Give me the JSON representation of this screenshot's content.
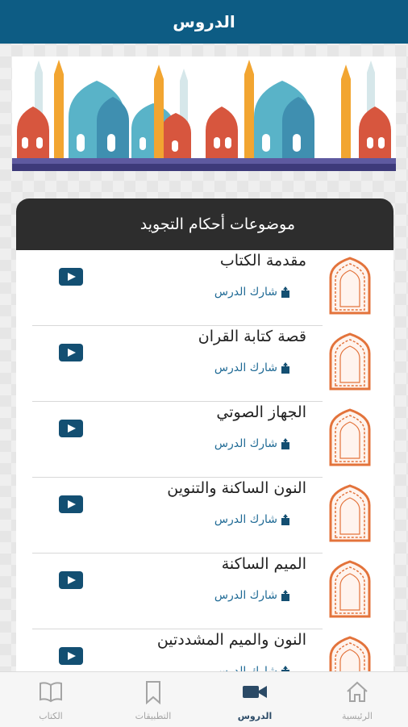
{
  "header": {
    "title": "الدروس"
  },
  "section": {
    "title": "موضوعات أحكام التجويد"
  },
  "lessons": [
    {
      "title": "مقدمة الكتاب",
      "share_label": "شارك الدرس"
    },
    {
      "title": "قصة كتابة القران",
      "share_label": "شارك الدرس"
    },
    {
      "title": "الجهاز الصوتي",
      "share_label": "شارك الدرس"
    },
    {
      "title": "النون الساكنة والتنوين",
      "share_label": "شارك الدرس"
    },
    {
      "title": "الميم الساكنة",
      "share_label": "شارك الدرس"
    },
    {
      "title": "النون والميم المشددتين",
      "share_label": "شارك الدرس"
    }
  ],
  "tabs": [
    {
      "label": "الرئيسية",
      "icon": "home-icon"
    },
    {
      "label": "الدروس",
      "icon": "video-icon",
      "active": true
    },
    {
      "label": "التطبيقات",
      "icon": "bookmark-icon"
    },
    {
      "label": "الكتاب",
      "icon": "book-icon"
    }
  ],
  "colors": {
    "primary": "#0d5c84",
    "header_dark": "#2d2d2d",
    "thumb_orange": "#e3733b",
    "active_tab": "#2b4a66",
    "inactive_tab": "#a4a4a4"
  }
}
